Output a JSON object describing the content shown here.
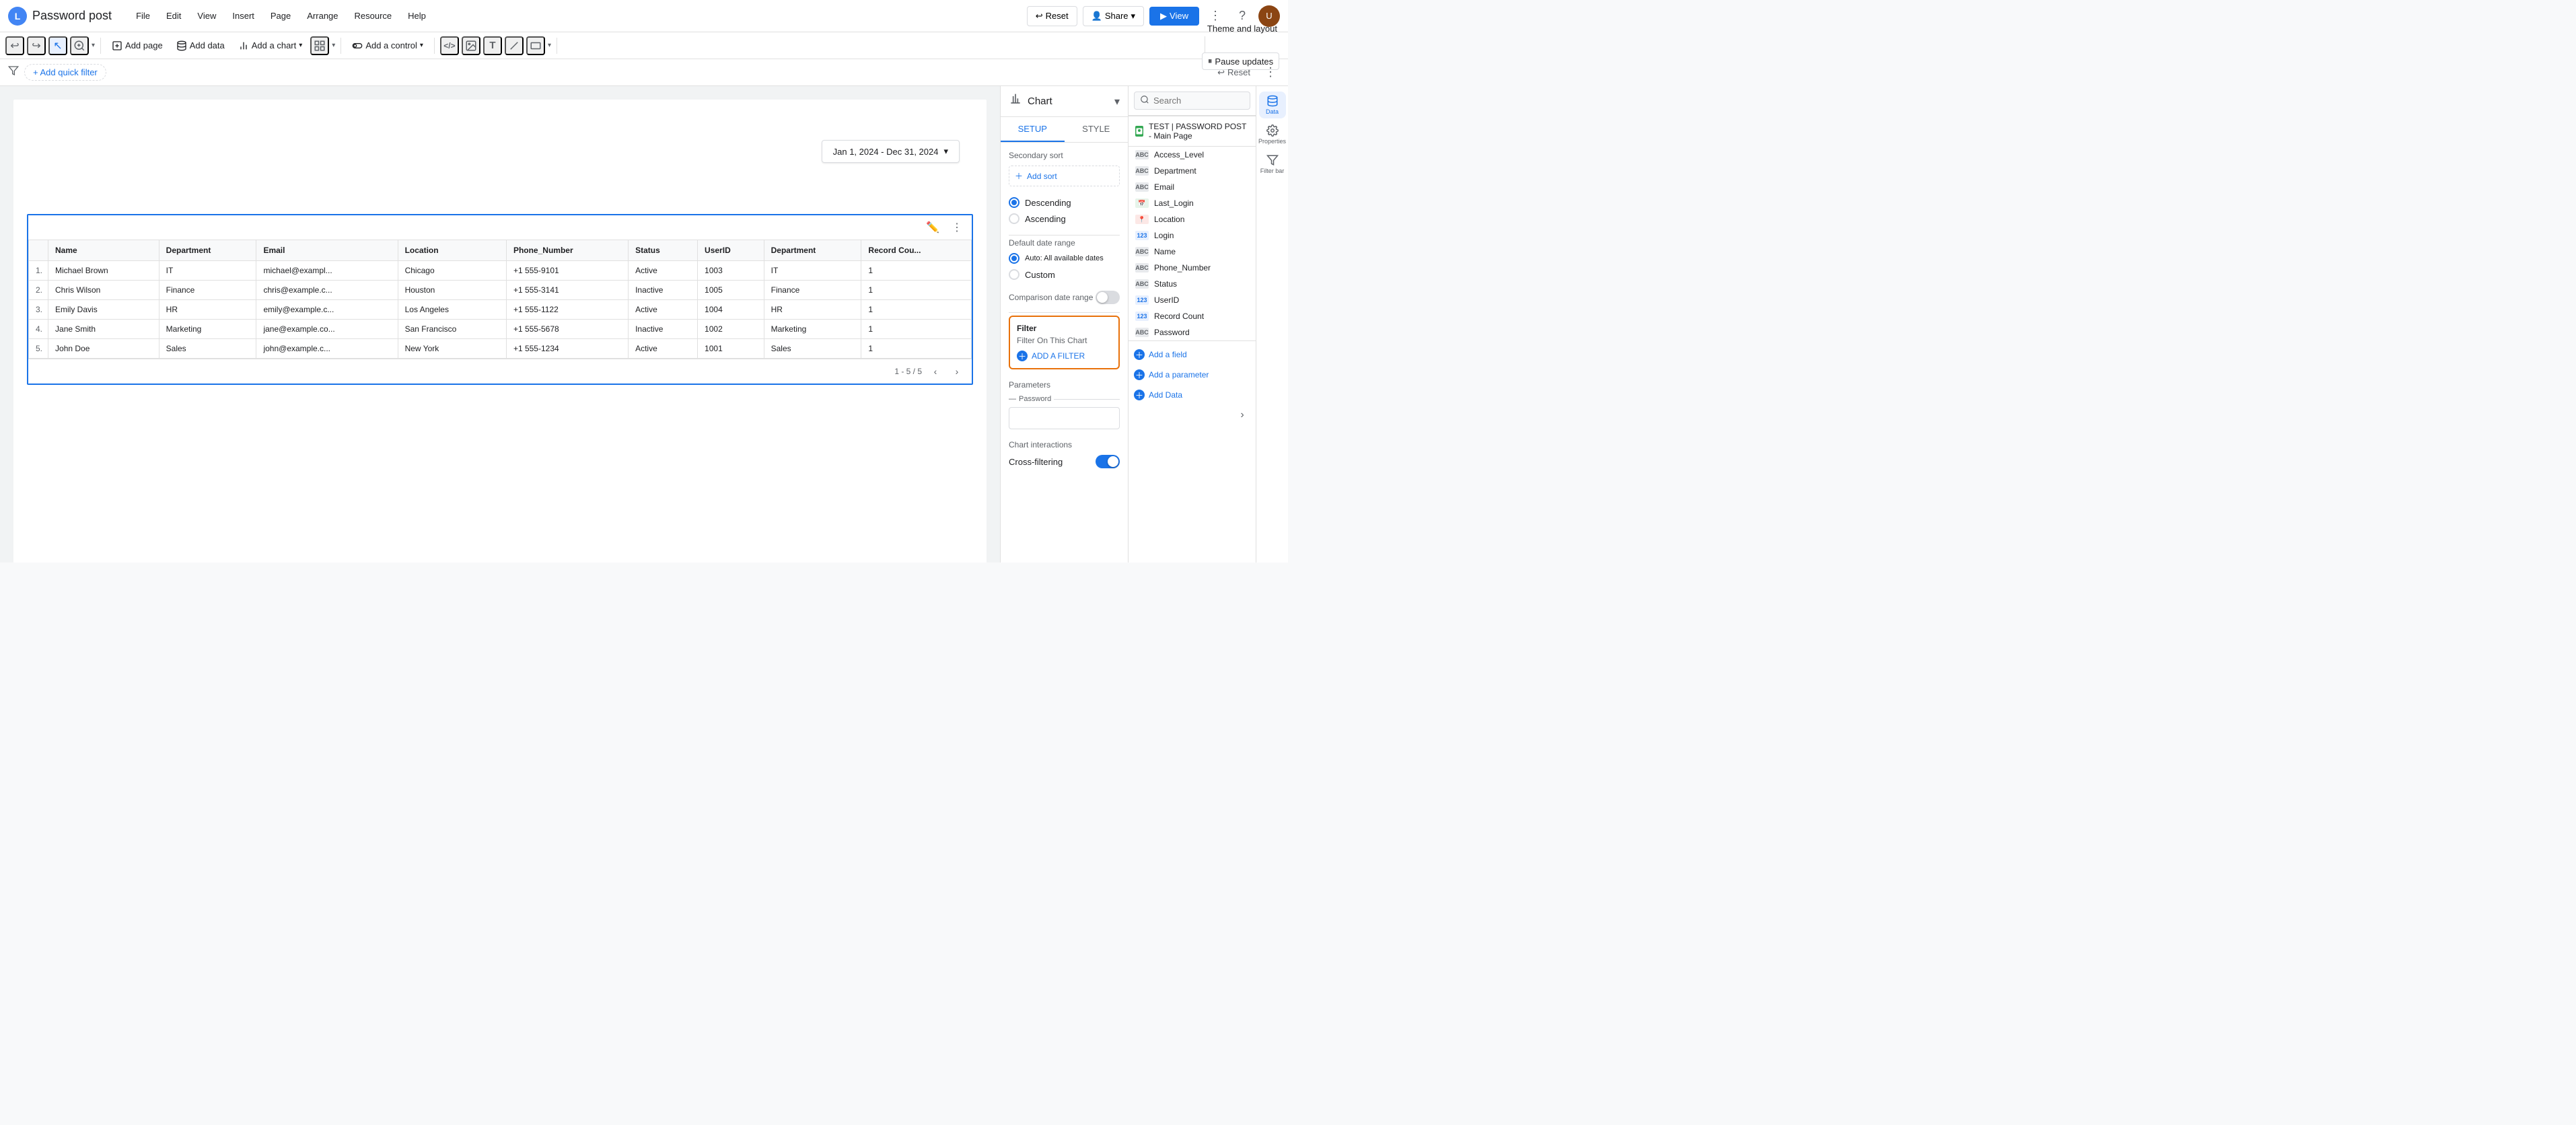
{
  "app": {
    "icon": "L",
    "title": "Password post"
  },
  "menu": {
    "items": [
      "File",
      "Edit",
      "View",
      "Insert",
      "Page",
      "Arrange",
      "Resource",
      "Help"
    ]
  },
  "topbar": {
    "reset_label": "Reset",
    "share_label": "Share",
    "view_label": "View",
    "more_icon": "⋮",
    "help_icon": "?",
    "pause_updates_label": "Pause updates"
  },
  "toolbar": {
    "undo_icon": "↩",
    "redo_icon": "↪",
    "select_icon": "↖",
    "zoom_icon": "⊕",
    "add_page_label": "Add page",
    "add_data_label": "Add data",
    "add_chart_label": "Add a chart",
    "arrange_icon": "⊞",
    "add_control_label": "Add a control",
    "code_icon": "<>",
    "image_icon": "🖼",
    "text_icon": "T",
    "line_icon": "╱",
    "rect_icon": "▭",
    "theme_layout_label": "Theme and layout"
  },
  "filter_bar": {
    "add_filter_label": "+ Add quick filter",
    "reset_label": "Reset",
    "more_icon": "⋮"
  },
  "canvas": {
    "date_filter": {
      "value": "Jan 1, 2024 - Dec 31, 2024",
      "chevron": "▾"
    },
    "table": {
      "headers": [
        "",
        "Name",
        "Department",
        "Email",
        "Location",
        "Phone_Number",
        "Status",
        "UserID",
        "Department",
        "Record Cou..."
      ],
      "rows": [
        [
          "1.",
          "Michael Brown",
          "IT",
          "michael@exampl...",
          "Chicago",
          "+1 555-9101",
          "Active",
          "1003",
          "IT",
          "1"
        ],
        [
          "2.",
          "Chris Wilson",
          "Finance",
          "chris@example.c...",
          "Houston",
          "+1 555-3141",
          "Inactive",
          "1005",
          "Finance",
          "1"
        ],
        [
          "3.",
          "Emily Davis",
          "HR",
          "emily@example.c...",
          "Los Angeles",
          "+1 555-1122",
          "Active",
          "1004",
          "HR",
          "1"
        ],
        [
          "4.",
          "Jane Smith",
          "Marketing",
          "jane@example.co...",
          "San Francisco",
          "+1 555-5678",
          "Inactive",
          "1002",
          "Marketing",
          "1"
        ],
        [
          "5.",
          "John Doe",
          "Sales",
          "john@example.c...",
          "New York",
          "+1 555-1234",
          "Active",
          "1001",
          "Sales",
          "1"
        ]
      ],
      "pagination": "1 - 5 / 5"
    }
  },
  "chart_panel": {
    "title": "Chart",
    "chevron": "▾",
    "tabs": {
      "setup": "SETUP",
      "style": "STYLE"
    },
    "secondary_sort": {
      "label": "Secondary sort",
      "add_sort_label": "Add sort",
      "sort_options": [
        {
          "label": "Descending",
          "selected": true
        },
        {
          "label": "Ascending",
          "selected": false
        }
      ]
    },
    "default_date_range": {
      "label": "Default date range",
      "options": [
        {
          "label": "Auto: All available dates",
          "selected": true
        },
        {
          "label": "Custom",
          "selected": false
        }
      ]
    },
    "comparison_date_range": {
      "label": "Comparison date range"
    },
    "filter": {
      "title": "Filter",
      "on_chart_label": "Filter On This Chart",
      "add_filter_label": "ADD A FILTER"
    },
    "parameters": {
      "label": "Parameters",
      "param_label": "Password",
      "param_value": ""
    },
    "chart_interactions": {
      "label": "Chart interactions",
      "cross_filtering_label": "Cross-filtering",
      "cross_filtering_enabled": true
    }
  },
  "data_panel": {
    "search_placeholder": "Search",
    "source": {
      "icon": "S",
      "name": "TEST | PASSWORD POST - Main Page"
    },
    "fields": [
      {
        "type": "abc",
        "name": "Access_Level"
      },
      {
        "type": "abc",
        "name": "Department"
      },
      {
        "type": "abc",
        "name": "Email"
      },
      {
        "type": "cal",
        "name": "Last_Login"
      },
      {
        "type": "loc",
        "name": "Location"
      },
      {
        "type": "123",
        "name": "Login"
      },
      {
        "type": "abc",
        "name": "Name"
      },
      {
        "type": "abc",
        "name": "Phone_Number"
      },
      {
        "type": "abc",
        "name": "Status"
      },
      {
        "type": "123",
        "name": "UserID"
      },
      {
        "type": "123",
        "name": "Record Count"
      },
      {
        "type": "abc",
        "name": "Password"
      }
    ],
    "footer": {
      "add_field_label": "Add a field",
      "add_parameter_label": "Add a parameter",
      "add_data_label": "Add Data"
    }
  },
  "side_tabs": {
    "data_label": "Data",
    "properties_label": "Properties",
    "filter_bar_label": "Filter bar"
  }
}
